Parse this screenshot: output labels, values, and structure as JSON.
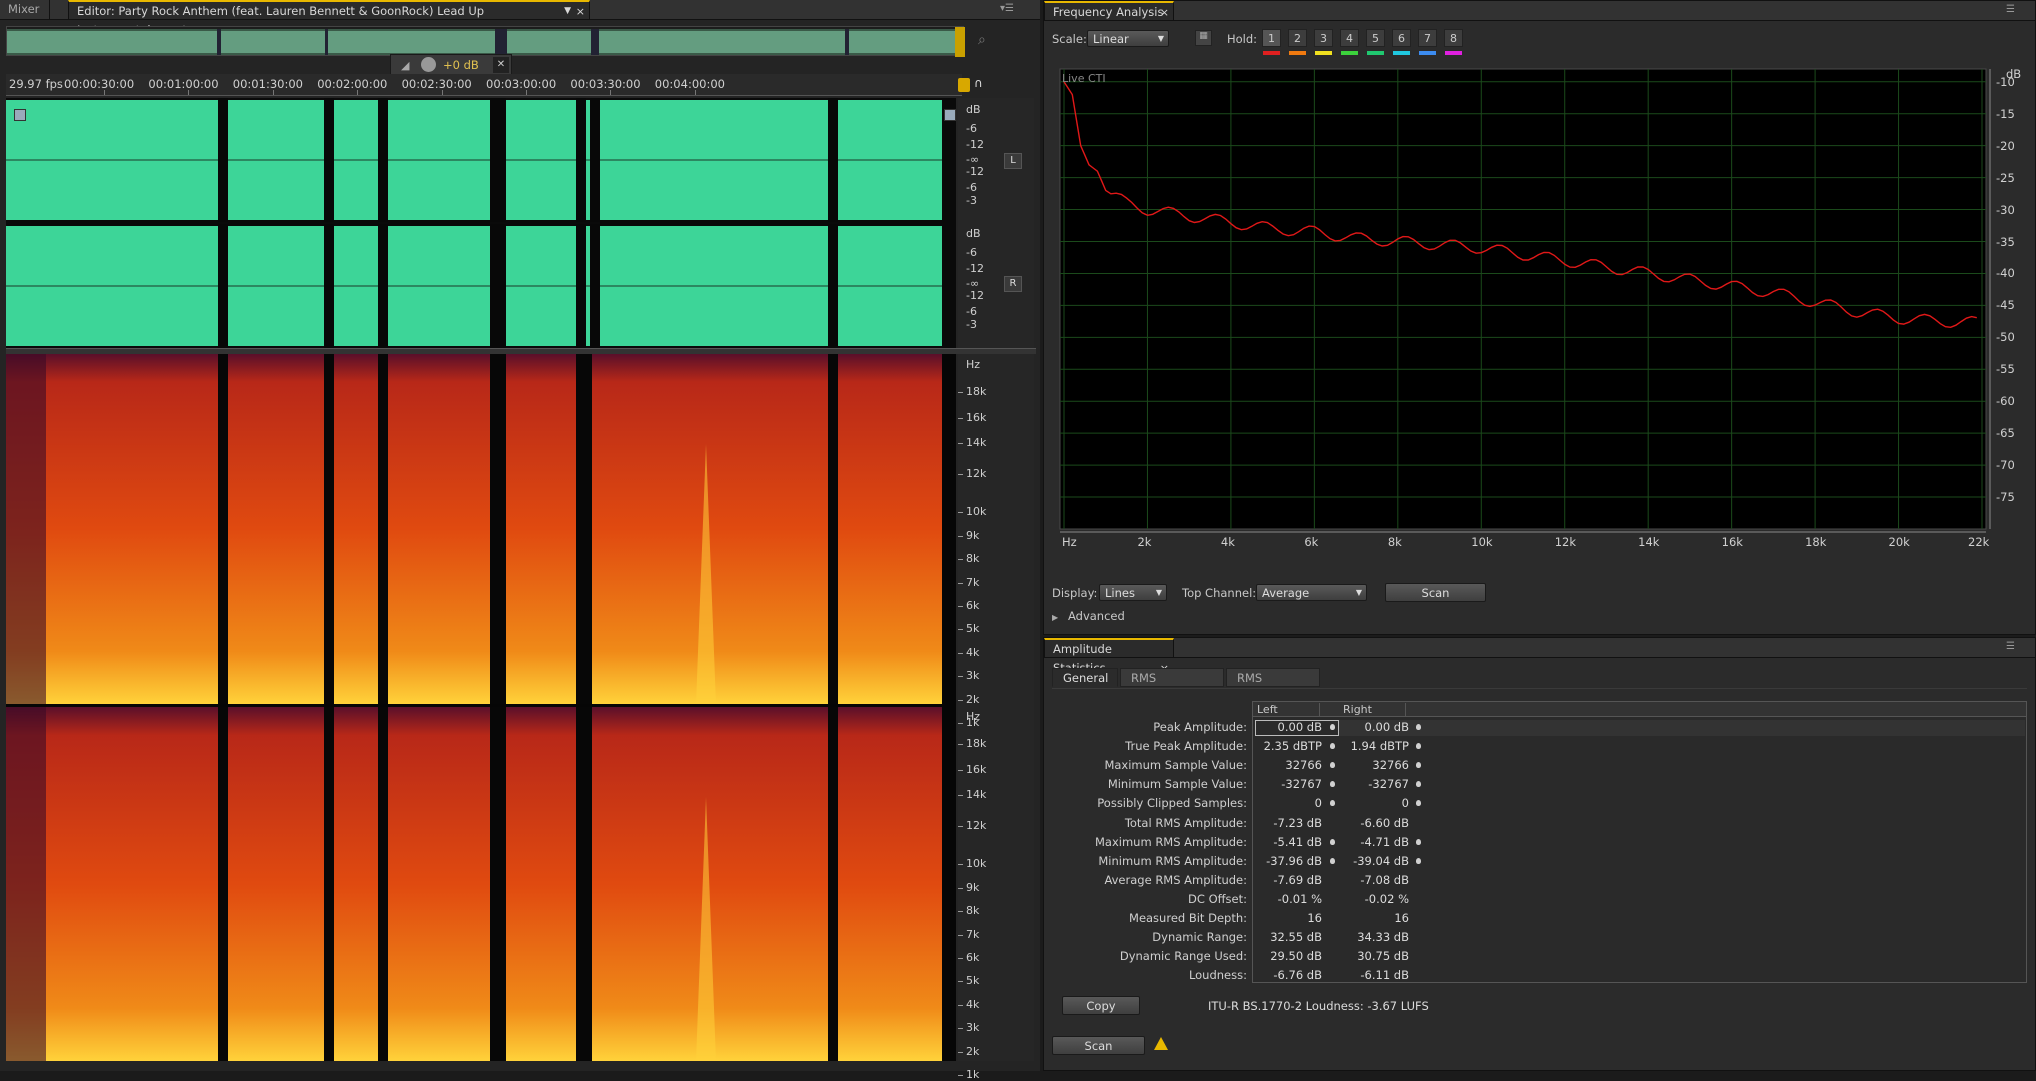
{
  "tabs": {
    "mixer": "Mixer",
    "editor": "Editor: Party Rock Anthem (feat. Lauren Bennett & GoonRock) Lead Up Instrumental.wav *",
    "frequency": "Frequency Analysis",
    "amplitude": "Amplitude Statistics"
  },
  "editor": {
    "fps": "29.97 fps",
    "hud_gain": "+0 dB",
    "timeline": [
      "00:00:30:00",
      "00:01:00:00",
      "00:01:30:00",
      "00:02:00:00",
      "00:02:30:00",
      "00:03:00:00",
      "00:03:30:00",
      "00:04:00:00"
    ],
    "db_scale_left": [
      "dB",
      "-6",
      "-12",
      "-∞",
      "-12",
      "-6",
      "-3"
    ],
    "db_scale_right": [
      "dB",
      "-6",
      "-12",
      "-∞",
      "-12",
      "-6",
      "-3"
    ],
    "channel_left": "L",
    "channel_right": "R",
    "hz_scale": [
      "Hz",
      "18k",
      "16k",
      "14k",
      "12k",
      "10k",
      "9k",
      "8k",
      "7k",
      "6k",
      "5k",
      "4k",
      "3k",
      "2k",
      "1k"
    ],
    "colors": {
      "waveform": "#3dd598",
      "spectral_low": "#2a0a2e",
      "spectral_high": "#ffd23a"
    }
  },
  "frequency": {
    "scale_label": "Scale:",
    "scale_value": "Linear",
    "hold_label": "Hold:",
    "hold_buttons": [
      "1",
      "2",
      "3",
      "4",
      "5",
      "6",
      "7",
      "8"
    ],
    "hold_colors": [
      "#e02020",
      "#f07a10",
      "#f0e020",
      "#3cd23c",
      "#20c870",
      "#20c8e0",
      "#3c8cf0",
      "#e020e0"
    ],
    "live_cti": "Live CTI",
    "y_unit": "dB",
    "y_ticks": [
      "-10",
      "-15",
      "-20",
      "-25",
      "-30",
      "-35",
      "-40",
      "-45",
      "-50",
      "-55",
      "-60",
      "-65",
      "-70",
      "-75"
    ],
    "x_ticks": [
      "Hz",
      "2k",
      "4k",
      "6k",
      "8k",
      "10k",
      "12k",
      "14k",
      "16k",
      "18k",
      "20k",
      "22k"
    ],
    "display_label": "Display:",
    "display_value": "Lines",
    "top_channel_label": "Top Channel:",
    "top_channel_value": "Average",
    "scan_label": "Scan",
    "advanced_label": "Advanced",
    "curve_color": "#e01818",
    "curve_db": [
      [
        0,
        -10
      ],
      [
        200,
        -12
      ],
      [
        400,
        -20
      ],
      [
        600,
        -23
      ],
      [
        800,
        -24
      ],
      [
        1000,
        -27
      ],
      [
        1500,
        -29
      ],
      [
        2000,
        -30
      ],
      [
        3000,
        -31
      ],
      [
        4000,
        -32
      ],
      [
        5000,
        -33
      ],
      [
        6000,
        -33.5
      ],
      [
        7000,
        -34.5
      ],
      [
        8000,
        -35
      ],
      [
        9000,
        -35.5
      ],
      [
        10000,
        -36
      ],
      [
        11000,
        -37
      ],
      [
        12000,
        -38
      ],
      [
        13000,
        -39
      ],
      [
        14000,
        -40
      ],
      [
        15000,
        -41
      ],
      [
        16000,
        -42
      ],
      [
        17000,
        -43
      ],
      [
        18000,
        -44.5
      ],
      [
        19000,
        -46
      ],
      [
        20000,
        -47
      ],
      [
        21000,
        -47.5
      ],
      [
        22000,
        -47.7
      ]
    ]
  },
  "amplitude": {
    "tabs": [
      "General",
      "RMS Histogram",
      "RMS Settings"
    ],
    "col_left": "Left",
    "col_right": "Right",
    "rows": [
      {
        "label": "Peak Amplitude:",
        "left": "0.00 dB",
        "right": "0.00 dB",
        "ldot": true,
        "rdot": true
      },
      {
        "label": "True Peak Amplitude:",
        "left": "2.35 dBTP",
        "right": "1.94 dBTP",
        "ldot": true,
        "rdot": true
      },
      {
        "label": "Maximum Sample Value:",
        "left": "32766",
        "right": "32766",
        "ldot": true,
        "rdot": true
      },
      {
        "label": "Minimum Sample Value:",
        "left": "-32767",
        "right": "-32767",
        "ldot": true,
        "rdot": true
      },
      {
        "label": "Possibly Clipped Samples:",
        "left": "0",
        "right": "0",
        "ldot": true,
        "rdot": true
      },
      {
        "label": "Total RMS Amplitude:",
        "left": "-7.23 dB",
        "right": "-6.60 dB",
        "ldot": false,
        "rdot": false
      },
      {
        "label": "Maximum RMS Amplitude:",
        "left": "-5.41 dB",
        "right": "-4.71 dB",
        "ldot": true,
        "rdot": true
      },
      {
        "label": "Minimum RMS Amplitude:",
        "left": "-37.96 dB",
        "right": "-39.04 dB",
        "ldot": true,
        "rdot": true
      },
      {
        "label": "Average RMS Amplitude:",
        "left": "-7.69 dB",
        "right": "-7.08 dB",
        "ldot": false,
        "rdot": false
      },
      {
        "label": "DC Offset:",
        "left": "-0.01 %",
        "right": "-0.02 %",
        "ldot": false,
        "rdot": false
      },
      {
        "label": "Measured Bit Depth:",
        "left": "16",
        "right": "16",
        "ldot": false,
        "rdot": false
      },
      {
        "label": "Dynamic Range:",
        "left": "32.55 dB",
        "right": "34.33 dB",
        "ldot": false,
        "rdot": false
      },
      {
        "label": "Dynamic Range Used:",
        "left": "29.50 dB",
        "right": "30.75 dB",
        "ldot": false,
        "rdot": false
      },
      {
        "label": "Loudness:",
        "left": "-6.76 dB",
        "right": "-6.11 dB",
        "ldot": false,
        "rdot": false
      }
    ],
    "copy_label": "Copy",
    "loudness_text": "ITU-R BS.1770-2 Loudness: -3.67 LUFS",
    "scan_label": "Scan"
  }
}
